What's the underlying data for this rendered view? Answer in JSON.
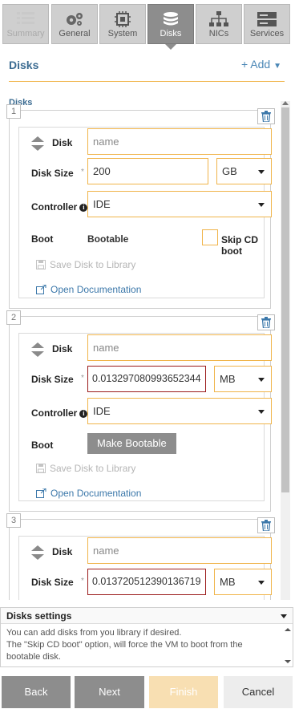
{
  "tabs": [
    {
      "label": "Summary",
      "icon": "list-icon",
      "state": "disabled"
    },
    {
      "label": "General",
      "icon": "gears-icon",
      "state": "normal"
    },
    {
      "label": "System",
      "icon": "chip-icon",
      "state": "normal"
    },
    {
      "label": "Disks",
      "icon": "database-icon",
      "state": "active"
    },
    {
      "label": "NICs",
      "icon": "network-icon",
      "state": "normal"
    },
    {
      "label": "Services",
      "icon": "server-icon",
      "state": "normal"
    }
  ],
  "section": {
    "title": "Disks",
    "add_label": "+ Add"
  },
  "disks_label": "Disks",
  "disks": [
    {
      "number": "1",
      "disk_label": "Disk",
      "name_placeholder": "name",
      "size_label": "Disk Size",
      "size_value": "200",
      "unit": "GB",
      "controller_label": "Controller",
      "controller_value": "IDE",
      "boot_label": "Boot",
      "boot_status": "Bootable",
      "skip_cd_label": "Skip CD boot",
      "save_label": "Save Disk to Library",
      "doc_label": "Open Documentation"
    },
    {
      "number": "2",
      "disk_label": "Disk",
      "name_placeholder": "name",
      "size_label": "Disk Size",
      "size_value": "0.013297080993652344",
      "unit": "MB",
      "controller_label": "Controller",
      "controller_value": "IDE",
      "boot_label": "Boot",
      "make_bootable_label": "Make Bootable",
      "save_label": "Save Disk to Library",
      "doc_label": "Open Documentation"
    },
    {
      "number": "3",
      "disk_label": "Disk",
      "name_placeholder": "name",
      "size_label": "Disk Size",
      "size_value": "0.013720512390136719",
      "unit": "MB"
    }
  ],
  "settings": {
    "title": "Disks settings",
    "lines": [
      "You can add disks from you library if desired.",
      "The \"Skip CD boot\" option, will force the VM to boot from the bootable disk."
    ]
  },
  "footer": {
    "back": "Back",
    "next": "Next",
    "finish": "Finish",
    "cancel": "Cancel"
  },
  "colors": {
    "accent": "#f0b44a",
    "link": "#3c78aa",
    "error": "#9b1b1b",
    "tab_active": "#8d8d8d"
  }
}
